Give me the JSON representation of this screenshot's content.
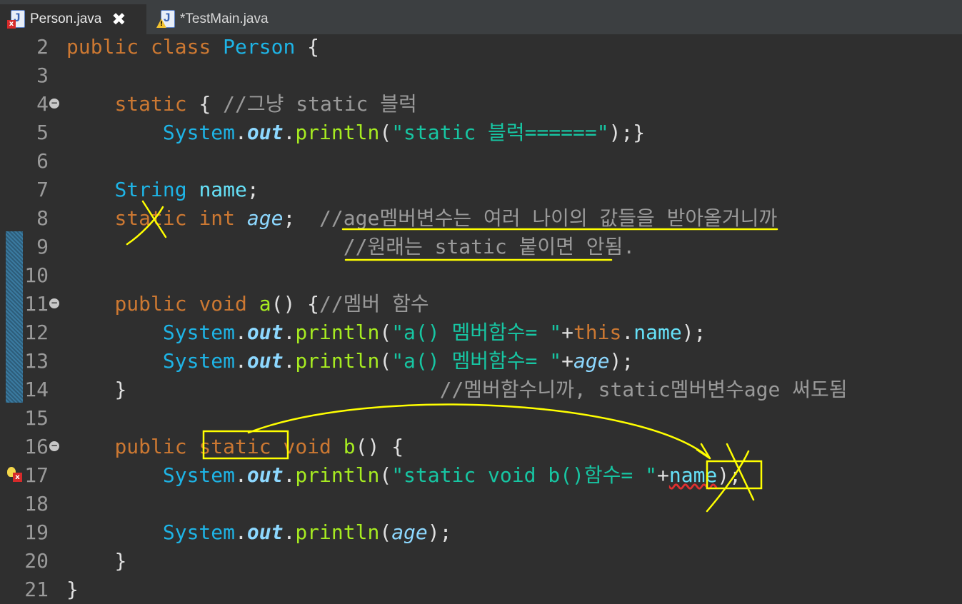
{
  "tabs": [
    {
      "label": "Person.java",
      "close": "✖",
      "active": true,
      "badge": "error"
    },
    {
      "label": "*TestMain.java",
      "active": false,
      "badge": "warning"
    }
  ],
  "icons": {
    "java_letter": "J",
    "error_glyph": "x",
    "fold_glyph": "−",
    "warning_glyph": "!"
  },
  "colors": {
    "keyword": "#cc7832",
    "type": "#1eb4e6",
    "string": "#17c6a3",
    "method": "#a7ec21",
    "comment": "#9a9a9a",
    "annotation": "#ffff00"
  },
  "code": {
    "l2": {
      "n": "2",
      "kw_public": "public",
      "kw_class": "class",
      "cls": "Person",
      "brace": " {"
    },
    "l3": {
      "n": "3"
    },
    "l4": {
      "n": "4",
      "kw_static": "static",
      "brace": " { ",
      "cmt": "//그냥 static 블럭"
    },
    "l5": {
      "n": "5",
      "sys": "System",
      "dot1": ".",
      "out": "out",
      "dot2": ".",
      "m": "println",
      "p1": "(",
      "s": "\"static 블럭======\"",
      "p2": ");}"
    },
    "l6": {
      "n": "6"
    },
    "l7": {
      "n": "7",
      "type": "String",
      "f": "name",
      "semi": ";"
    },
    "l8": {
      "n": "8",
      "kw_static": "static",
      "kw_int": "int",
      "f": "age",
      "semi": ";",
      "cmt": "//age멤버변수는 여러 나이의 값들을 받아올거니까"
    },
    "l9": {
      "n": "9",
      "cmt": "//원래는 static 붙이면 안됨."
    },
    "l10": {
      "n": "10"
    },
    "l11": {
      "n": "11",
      "kw_public": "public",
      "kw_void": "void",
      "m": "a",
      "p": "() {",
      "cmt": "//멤버 함수"
    },
    "l12": {
      "n": "12",
      "sys": "System",
      "dot1": ".",
      "out": "out",
      "dot2": ".",
      "m": "println",
      "p1": "(",
      "s": "\"a() 멤버함수= \"",
      "plus": "+",
      "kw_this": "this",
      "dot3": ".",
      "f": "name",
      "p2": ");"
    },
    "l13": {
      "n": "13",
      "sys": "System",
      "dot1": ".",
      "out": "out",
      "dot2": ".",
      "m": "println",
      "p1": "(",
      "s": "\"a() 멤버함수= \"",
      "plus": "+",
      "f": "age",
      "p2": ");"
    },
    "l14": {
      "n": "14",
      "brace": "}",
      "cmt": "//멤버함수니까, static멤버변수age 써도됨"
    },
    "l15": {
      "n": "15"
    },
    "l16": {
      "n": "16",
      "kw_public": "public",
      "kw_static": "static",
      "kw_void": "void",
      "m": "b",
      "p": "() {"
    },
    "l17": {
      "n": "17",
      "sys": "System",
      "dot1": ".",
      "out": "out",
      "dot2": ".",
      "m": "println",
      "p1": "(",
      "s": "\"static void b()함수= \"",
      "plus": "+",
      "f": "name",
      "p2": ");"
    },
    "l18": {
      "n": "18"
    },
    "l19": {
      "n": "19",
      "sys": "System",
      "dot1": ".",
      "out": "out",
      "dot2": ".",
      "m": "println",
      "p1": "(",
      "f": "age",
      "p2": ");"
    },
    "l20": {
      "n": "20",
      "brace": "}"
    },
    "l21": {
      "n": "21",
      "brace": "}"
    }
  }
}
